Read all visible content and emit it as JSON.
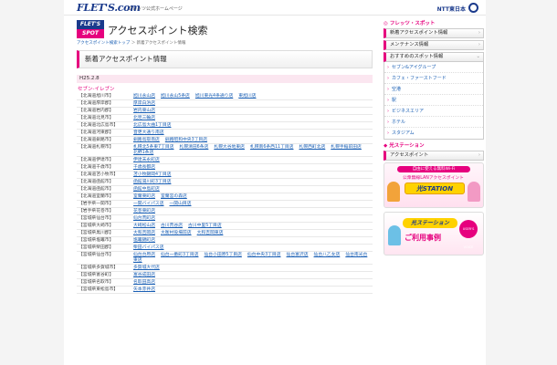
{
  "header": {
    "logo": "FLET'S.com",
    "logo_sub": "フレッツ公式ホームページ",
    "ntt": "NTT東日本"
  },
  "title": {
    "spot_top": "FLET'S",
    "spot_bottom": "SPOT",
    "heading": "アクセスポイント検索",
    "breadcrumb": [
      "アクセスポイント検索トップ",
      "新着アクセスポイント情報"
    ]
  },
  "main": {
    "section_title": "新着アクセスポイント情報",
    "date": "H25.2.8",
    "category": "セブン-イレブン",
    "rows": [
      {
        "area": "【北海道旭川市】",
        "shops": [
          "旭川永山店",
          "旭川永山5条店",
          "旭川東光4条通り店",
          "東旭川店"
        ]
      },
      {
        "area": "【北海道厚岸郡】",
        "shops": [
          "厚岸白浜店"
        ]
      },
      {
        "area": "【北海道岩内郡】",
        "shops": [
          "岩内東山店"
        ]
      },
      {
        "area": "【北海道北見市】",
        "shops": [
          "北見三輪店"
        ]
      },
      {
        "area": "【北海道北広島市】",
        "shops": [
          "北広島大曲1丁目店"
        ]
      },
      {
        "area": "【北海道河東郡】",
        "shops": [
          "音更大通り南店"
        ]
      },
      {
        "area": "【北海道釧路市】",
        "shops": [
          "釧路鳥取南店",
          "釧路昭和中央3丁目店"
        ]
      },
      {
        "area": "【北海道札幌市】",
        "shops": [
          "札幌北5条東7丁目店",
          "札幌清田6条店",
          "札幌大谷地東店",
          "札幌南6条西11丁目店",
          "札幌西町北店",
          "札幌手稲前田店",
          "北野1条店"
        ]
      },
      {
        "area": "【北海道伊達市】",
        "shops": [
          "伊達末永町店"
        ]
      },
      {
        "area": "【北海道千歳市】",
        "shops": [
          "千歳長都店"
        ]
      },
      {
        "area": "【北海道苫小牧市】",
        "shops": [
          "苫小牧錦岡4丁目店"
        ]
      },
      {
        "area": "【北海道函館市】",
        "shops": [
          "函館湯川町3丁目店"
        ]
      },
      {
        "area": "【北海道函館市】",
        "shops": [
          "函館中島町店"
        ]
      },
      {
        "area": "【北海道室蘭市】",
        "shops": [
          "室蘭東町店",
          "室蘭宮の森店"
        ]
      },
      {
        "area": "【岩手県一関市】",
        "shops": [
          "一関バイパス店",
          "一関山目店"
        ]
      },
      {
        "area": "【岩手県花巻市】",
        "shops": [
          "花巻東町店"
        ]
      },
      {
        "area": "【宮城県仙台市】",
        "shops": [
          "仙台荒町店"
        ]
      },
      {
        "area": "【宮城県大崎市】",
        "shops": [
          "大崎松山店",
          "古川荒谷店",
          "古川中里5丁目店"
        ]
      },
      {
        "area": "【宮城県黒川郡】",
        "shops": [
          "大和吉岡店",
          "大衡村役場前店",
          "大和吉岡東店"
        ]
      },
      {
        "area": "【宮城県塩竈市】",
        "shops": [
          "塩竈錦町店"
        ]
      },
      {
        "area": "【宮城県柴田郡】",
        "shops": [
          "柴田バイパス店"
        ]
      },
      {
        "area": "【宮城県仙台市】",
        "shops": [
          "仙台台原店",
          "仙台一番町3丁目店",
          "仙台小田原5丁目店",
          "仙台中央3丁目店",
          "仙台富沢店",
          "仙台八乙女店",
          "仙台南光台東店"
        ]
      },
      {
        "area": "【宮城県多賀城市】",
        "shops": [
          "多賀城大代店"
        ]
      },
      {
        "area": "【宮城県富谷町】",
        "shops": [
          "富谷成田店"
        ]
      },
      {
        "area": "【宮城県名取市】",
        "shops": [
          "名取田高店"
        ]
      },
      {
        "area": "【宮城県東松島市】",
        "shops": [
          "矢本赤井店"
        ]
      }
    ]
  },
  "sidebar": {
    "section1_title": "フレッツ・スポット",
    "buttons": [
      "新着アクセスポイント情報",
      "メンテナンス情報",
      "おすすめのスポット情報"
    ],
    "spot_list": [
      "セブン&アイグループ",
      "カフェ・ファーストフード",
      "空港",
      "駅",
      "ビジネスエリア",
      "ホテル",
      "スタジアム"
    ],
    "section2_title": "光ステーション",
    "ap_button": "アクセスポイント",
    "banner1": {
      "line1": "自由に使える無料Wi-Fi",
      "line2": "公衆無線LANアクセスポイント",
      "station": "光STATION"
    },
    "banner2": {
      "title": "光ステーション",
      "sub": "ご利用事例",
      "badge": "USER'S VOICE"
    }
  },
  "colors": {
    "accent": "#e6007e",
    "brand": "#1a3a8c",
    "link": "#1a5fb4"
  }
}
